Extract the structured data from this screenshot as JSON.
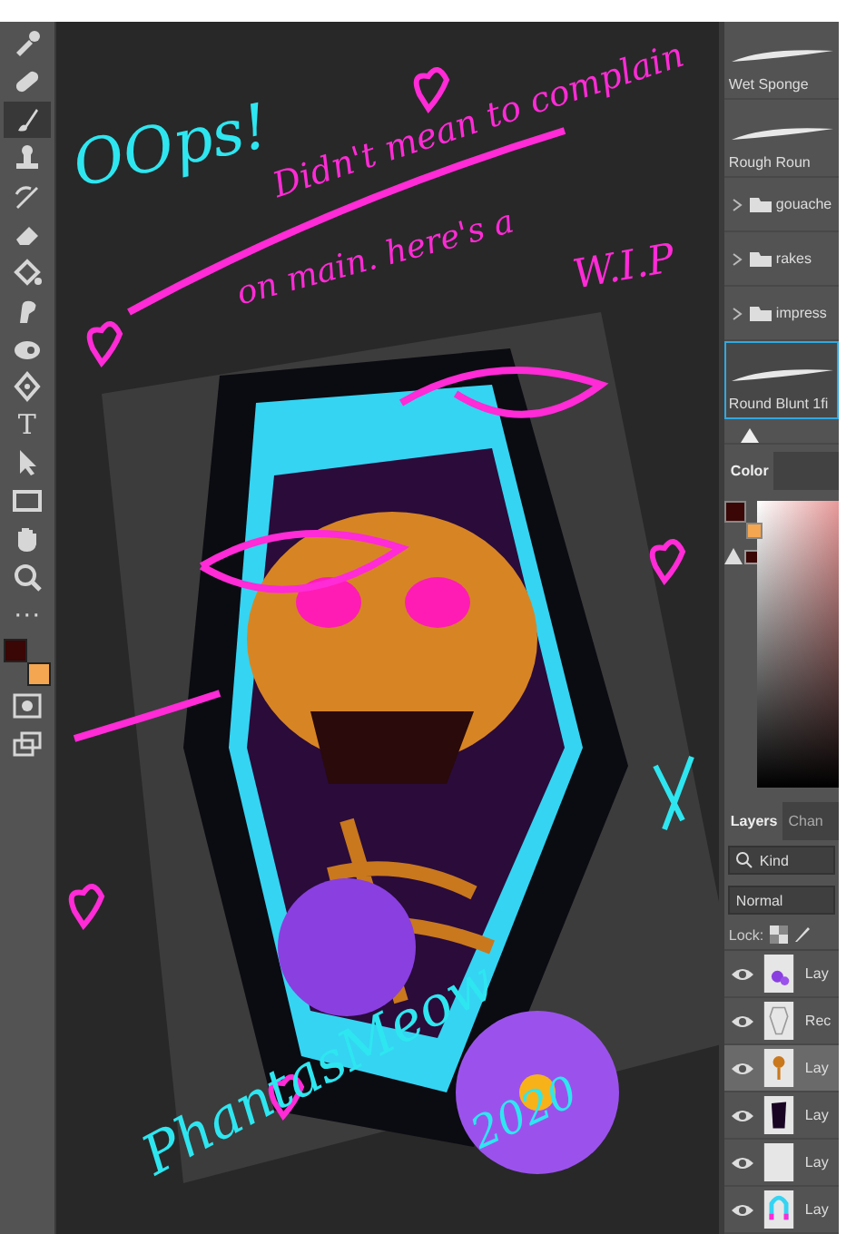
{
  "toolbar": {
    "tools": [
      {
        "kind": "eyedropper",
        "selected": false
      },
      {
        "kind": "heal",
        "selected": false
      },
      {
        "kind": "brush",
        "selected": true
      },
      {
        "kind": "stamp",
        "selected": false
      },
      {
        "kind": "history",
        "selected": false
      },
      {
        "kind": "eraser",
        "selected": false
      },
      {
        "kind": "bucket",
        "selected": false
      },
      {
        "kind": "smudge",
        "selected": false
      },
      {
        "kind": "dodge",
        "selected": false
      },
      {
        "kind": "pen",
        "selected": false
      },
      {
        "kind": "type",
        "label": "T",
        "selected": false
      },
      {
        "kind": "select",
        "selected": false
      },
      {
        "kind": "rect",
        "selected": false
      },
      {
        "kind": "hand",
        "selected": false
      },
      {
        "kind": "zoom",
        "selected": false
      },
      {
        "kind": "more",
        "label": "···",
        "selected": false
      }
    ]
  },
  "annotations": [
    {
      "kind": "title",
      "text": "OOps!",
      "color": "#2ee6f0"
    },
    {
      "kind": "line",
      "text": "Didn't mean to complain",
      "color": "#ff2bd6"
    },
    {
      "kind": "line",
      "text": "on main. here's a",
      "color": "#ff2bd6"
    },
    {
      "kind": "line",
      "text": "W.I.P",
      "color": "#ff2bd6"
    },
    {
      "kind": "sign",
      "text": "PhantasMeow",
      "color": "#2ee6f0"
    },
    {
      "kind": "date",
      "text": "2020",
      "color": "#2ee6f0"
    }
  ],
  "brushes": [
    {
      "kind": "brush",
      "label": "Wet Sponge",
      "selected": false
    },
    {
      "kind": "brush",
      "label": "Rough Roun",
      "selected": false
    },
    {
      "kind": "folder",
      "label": "gouache",
      "selected": false
    },
    {
      "kind": "folder",
      "label": "rakes",
      "selected": false
    },
    {
      "kind": "folder",
      "label": "impress",
      "selected": false
    },
    {
      "kind": "brush",
      "label": "Round Blunt 1fi",
      "selected": true
    }
  ],
  "size_slider": {
    "level": 0.15
  },
  "color_panel": {
    "tab": "Color"
  },
  "layers_panel": {
    "tabs": [
      {
        "label": "Layers",
        "selected": true
      },
      {
        "label": "Chan",
        "selected": false
      }
    ],
    "search": "Kind",
    "blend_mode": "Normal",
    "lock_label": "Lock:",
    "layers": [
      {
        "name": "Lay",
        "kind": "flowers",
        "visible": true,
        "selected": false
      },
      {
        "name": "Rec",
        "kind": "coffin",
        "visible": true,
        "selected": false
      },
      {
        "name": "Lay",
        "kind": "skull",
        "visible": true,
        "selected": true
      },
      {
        "name": "Lay",
        "kind": "dark",
        "visible": true,
        "selected": false
      },
      {
        "name": "Lay",
        "kind": "blank",
        "visible": true,
        "selected": false
      },
      {
        "name": "Lay",
        "kind": "arch",
        "visible": true,
        "selected": false
      }
    ]
  }
}
